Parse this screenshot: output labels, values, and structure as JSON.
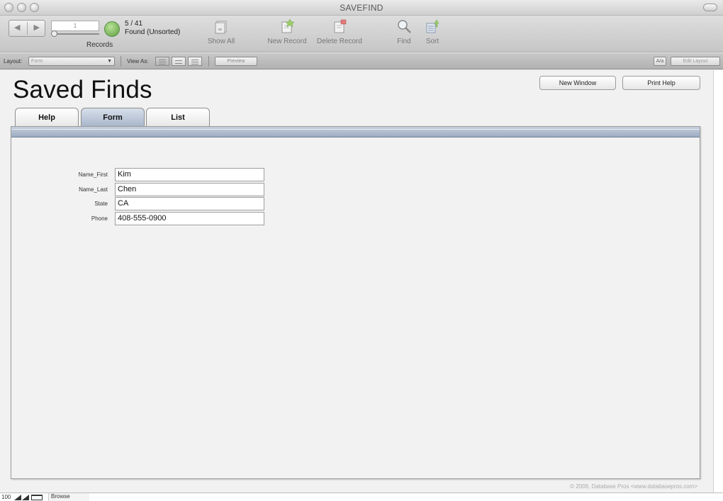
{
  "window": {
    "title": "SAVEFIND"
  },
  "toolbar": {
    "record_number": "1",
    "found_count": "5 / 41",
    "found_status": "Found (Unsorted)",
    "records_label": "Records",
    "show_all_label": "Show All",
    "new_record_label": "New Record",
    "delete_record_label": "Delete Record",
    "find_label": "Find",
    "sort_label": "Sort",
    "found_color": "#6fb24c"
  },
  "layout_bar": {
    "layout_label": "Layout:",
    "layout_value": "Form",
    "view_as_label": "View As:",
    "preview_label": "Preview",
    "aa_label": "A/a",
    "edit_layout_label": "Edit Layout"
  },
  "page": {
    "title": "Saved Finds",
    "new_window_label": "New Window",
    "print_help_label": "Print Help",
    "tabs": [
      {
        "label": "Help"
      },
      {
        "label": "Form"
      },
      {
        "label": "List"
      }
    ],
    "active_tab": "Form",
    "tab_active_color": "#a9b7cb",
    "fields": [
      {
        "label": "Name_First",
        "value": "Kim"
      },
      {
        "label": "Name_Last",
        "value": "Chen"
      },
      {
        "label": "State",
        "value": "CA"
      },
      {
        "label": "Phone",
        "value": "408-555-0900"
      }
    ],
    "copyright": "© 2009, Database Pros <www.databasepros.com>"
  },
  "status_bar": {
    "zoom": "100",
    "mode": "Browse"
  }
}
